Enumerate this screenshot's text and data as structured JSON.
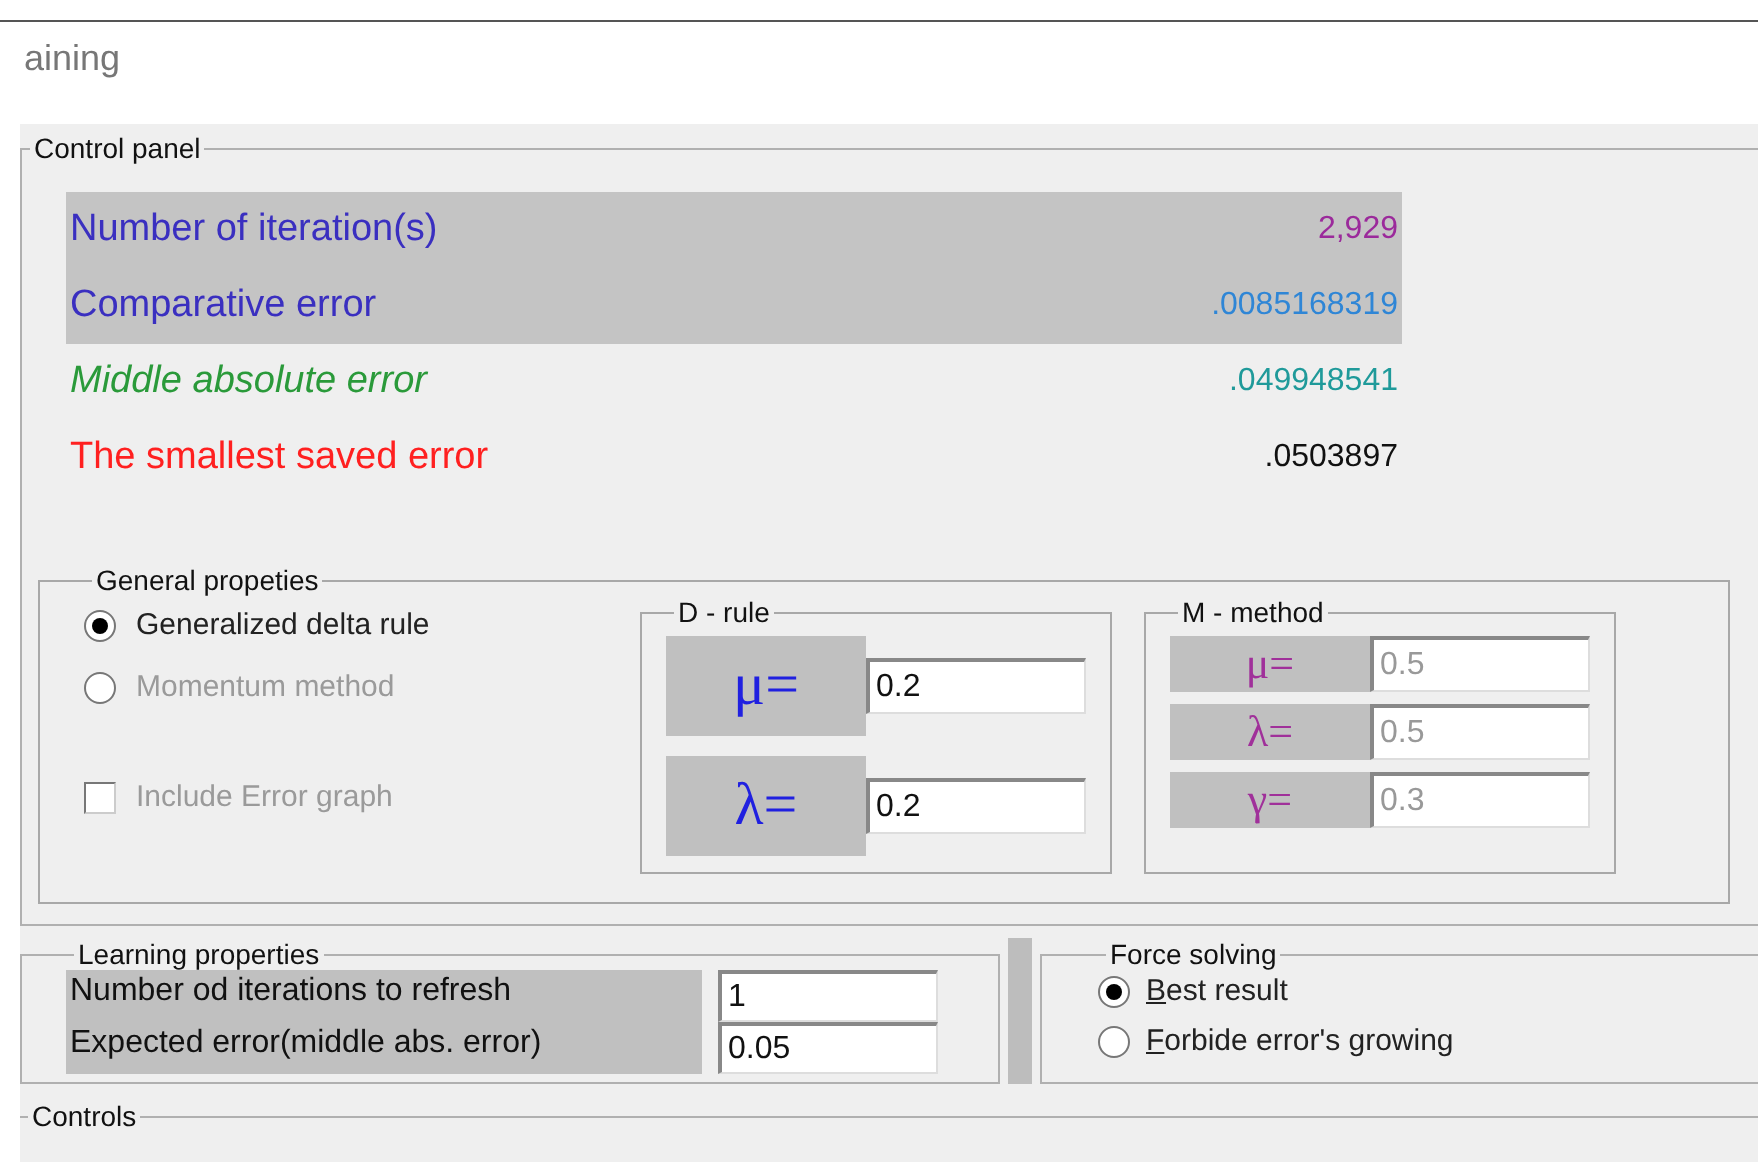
{
  "header": {
    "title": "aining"
  },
  "control_panel": {
    "title": "Control panel",
    "metrics": [
      {
        "label": "Number of iteration(s)",
        "value": {
          "text": "2,929",
          "color": "#9b2a9b"
        },
        "color": "#3a2fc0",
        "italic": false,
        "highlighted": true
      },
      {
        "label": "Comparative error",
        "value": {
          "text": ".0085168319",
          "color": "#2f86d6"
        },
        "color": "#3a2fc0",
        "italic": false,
        "highlighted": true
      },
      {
        "label": "Middle absolute error",
        "value": {
          "text": ".049948541",
          "color": "#1f9a9a"
        },
        "color": "#2a9a3a",
        "italic": true,
        "highlighted": false
      },
      {
        "label": "The smallest saved error",
        "value": {
          "text": ".0503897",
          "color": "#111111"
        },
        "color": "#ff2020",
        "italic": false,
        "highlighted": false
      }
    ]
  },
  "general": {
    "title": "General propeties",
    "options": [
      {
        "kind": "radio",
        "label": "Generalized delta rule",
        "selected": true,
        "disabled": false
      },
      {
        "kind": "radio",
        "label": "Momentum method",
        "selected": false,
        "disabled": true
      },
      {
        "kind": "checkbox",
        "label": "Include Error graph",
        "checked": false,
        "disabled": true
      }
    ],
    "d_rule": {
      "title": "D - rule",
      "disabled": false,
      "params": [
        {
          "symbol": "μ=",
          "value": "0.2"
        },
        {
          "symbol": "λ=",
          "value": "0.2"
        }
      ]
    },
    "m_method": {
      "title": "M - method",
      "disabled": true,
      "params": [
        {
          "symbol": "μ=",
          "value": "0.5"
        },
        {
          "symbol": "λ=",
          "value": "0.5"
        },
        {
          "symbol": "γ=",
          "value": "0.3"
        }
      ]
    }
  },
  "learning": {
    "title": "Learning properties",
    "fields": [
      {
        "label": "Number od iterations to refresh",
        "value": "1"
      },
      {
        "label": "Expected error(middle abs. error)",
        "value": "0.05"
      }
    ]
  },
  "force": {
    "title": "Force solving",
    "options": [
      {
        "label": "Best result",
        "selected": true,
        "underline_first": true
      },
      {
        "label": "Forbide error's growing",
        "selected": false,
        "underline_first": true
      }
    ]
  },
  "controls": {
    "title": "Controls"
  }
}
